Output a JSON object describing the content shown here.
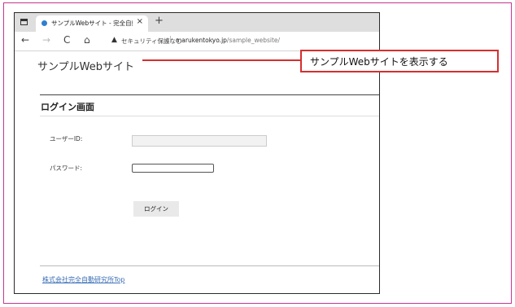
{
  "browser": {
    "tab": {
      "title": "サンプルWebサイト - 完全自動化研",
      "close_glyph": "×"
    },
    "newtab_glyph": "+",
    "nav": {
      "back_glyph": "←",
      "forward_glyph": "→",
      "reload_glyph": "C",
      "home_glyph": "⌂"
    },
    "address": {
      "warn_glyph": "▲",
      "security_label": "セキュリティ保護なし",
      "separator": "|",
      "url_host": "marukentokyo.jp",
      "url_path": "/sample_website/"
    }
  },
  "page": {
    "site_title": "サンプルWebサイト",
    "login_heading": "ログイン画面",
    "user_id_label": "ユーザーID:",
    "user_id_value": "",
    "password_label": "パスワード:",
    "password_value": "",
    "login_button": "ログイン",
    "footer_link": "株式会社完全自動研究所Top"
  },
  "annotation": {
    "callout_text": "サンプルWebサイトを表示する",
    "color": "#d62f2f"
  },
  "colors": {
    "frame_border": "#c2388f",
    "link": "#3b6fb6"
  }
}
